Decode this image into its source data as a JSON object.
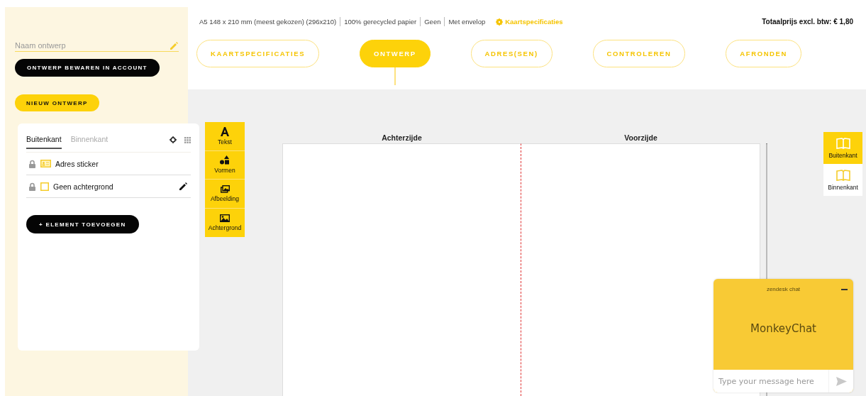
{
  "sidebar": {
    "name_field": {
      "placeholder": "Naam ontwerp"
    },
    "save_button": "ONTWERP BEWAREN IN ACCOUNT",
    "new_button": "NIEUW ONTWERP",
    "layers_panel": {
      "tabs": [
        {
          "label": "Buitenkant",
          "selected": true
        },
        {
          "label": "Binnenkant",
          "selected": false
        }
      ],
      "layers": [
        {
          "label": "Adres sticker",
          "kind": "address",
          "locked": true,
          "editable": false
        },
        {
          "label": "Geen achtergrond",
          "kind": "background",
          "locked": true,
          "editable": true
        }
      ],
      "add_button": "+ ELEMENT TOEVOEGEN"
    }
  },
  "header": {
    "specs": [
      "A5 148 x 210 mm (meest gekozen) (296x210)",
      "100% gerecycled papier",
      "Geen",
      "Met envelop"
    ],
    "specs_link": "Kaartspecificaties",
    "total": "Totaalprijs excl. btw: € 1,80",
    "steps": [
      {
        "label": "KAARTSPECIFICATIES",
        "selected": false
      },
      {
        "label": "ONTWERP",
        "selected": true
      },
      {
        "label": "ADRES(SEN)",
        "selected": false
      },
      {
        "label": "CONTROLEREN",
        "selected": false
      },
      {
        "label": "AFRONDEN",
        "selected": false
      }
    ]
  },
  "tools": [
    {
      "label": "Tekst",
      "kind": "text"
    },
    {
      "label": "Vormen",
      "kind": "shapes"
    },
    {
      "label": "Afbeelding",
      "kind": "image"
    },
    {
      "label": "Achtergrond",
      "kind": "background"
    }
  ],
  "canvas": {
    "pages": [
      {
        "label": "Achterzijde"
      },
      {
        "label": "Voorzijde"
      }
    ]
  },
  "sides": [
    {
      "label": "Buitenkant",
      "selected": true
    },
    {
      "label": "Binnenkant",
      "selected": false
    }
  ],
  "chat": {
    "brand": "zendesk chat",
    "title": "MonkeyChat",
    "input": {
      "placeholder": "Type your message here"
    }
  }
}
